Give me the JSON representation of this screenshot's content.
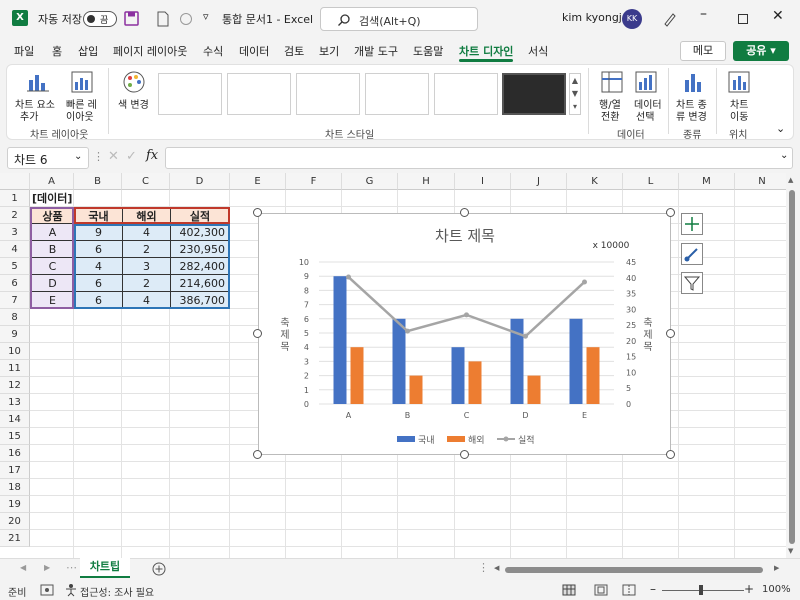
{
  "titlebar": {
    "autosave_label": "자동 저장",
    "toggle_state": "끔",
    "doc_title": "통합 문서1  -  Excel",
    "search_placeholder": "검색(Alt+Q)",
    "user_name": "kim kyongja",
    "user_initials": "KK",
    "brand_color": "#107c41"
  },
  "tabs": [
    "파일",
    "홈",
    "삽입",
    "페이지 레이아웃",
    "수식",
    "데이터",
    "검토",
    "보기",
    "개발 도구",
    "도움말",
    "차트 디자인",
    "서식"
  ],
  "active_tab": "차트 디자인",
  "ribbon": {
    "add_element_l1": "차트 요소",
    "add_element_l2": "추가",
    "quick_layout_l1": "빠른 레",
    "quick_layout_l2": "이아웃",
    "change_color": "색 변경",
    "switch_l1": "행/열",
    "switch_l2": "전환",
    "select_data_l1": "데이터",
    "select_data_l2": "선택",
    "change_type_l1": "차트 종",
    "change_type_l2": "류 변경",
    "move_chart_l1": "차트",
    "move_chart_l2": "이동",
    "group_layouts": "차트 레이아웃",
    "group_styles": "차트 스타일",
    "group_data": "데이터",
    "group_type": "종류",
    "group_location": "위치",
    "memo": "메모",
    "share": "공유"
  },
  "formula_bar": {
    "name_box": "차트 6",
    "fx": "fx"
  },
  "columns": [
    "A",
    "B",
    "C",
    "D",
    "E",
    "F",
    "G",
    "H",
    "I",
    "J",
    "K",
    "L",
    "M",
    "N"
  ],
  "rows": [
    "1",
    "2",
    "3",
    "4",
    "5",
    "6",
    "7",
    "8",
    "9",
    "10",
    "11",
    "12",
    "13",
    "14",
    "15",
    "16",
    "17",
    "18",
    "19",
    "20",
    "21"
  ],
  "sheet": {
    "a1": "[데이터]",
    "headers": [
      "상품",
      "국내",
      "해외",
      "실적"
    ],
    "data": [
      [
        "A",
        "9",
        "4",
        "402,300"
      ],
      [
        "B",
        "6",
        "2",
        "230,950"
      ],
      [
        "C",
        "4",
        "3",
        "282,400"
      ],
      [
        "D",
        "6",
        "2",
        "214,600"
      ],
      [
        "E",
        "6",
        "4",
        "386,700"
      ]
    ]
  },
  "chart_data": {
    "type": "bar",
    "title": "차트 제목",
    "secondary_unit": "x 10000",
    "ylabel": "축 제목",
    "y2label": "축 제목",
    "categories": [
      "A",
      "B",
      "C",
      "D",
      "E"
    ],
    "ylim": [
      0,
      10
    ],
    "y_ticks": [
      "0",
      "1",
      "2",
      "3",
      "4",
      "5",
      "6",
      "7",
      "8",
      "9",
      "10"
    ],
    "y2lim": [
      0,
      45
    ],
    "y2_ticks": [
      "0",
      "5",
      "10",
      "15",
      "20",
      "25",
      "30",
      "35",
      "40",
      "45"
    ],
    "series": [
      {
        "name": "국내",
        "kind": "bar",
        "axis": "primary",
        "color": "#4472c4",
        "values": [
          9,
          6,
          4,
          6,
          6
        ]
      },
      {
        "name": "해외",
        "kind": "bar",
        "axis": "primary",
        "color": "#ed7d31",
        "values": [
          4,
          2,
          3,
          2,
          4
        ]
      },
      {
        "name": "실적",
        "kind": "line",
        "axis": "secondary",
        "color": "#a5a5a5",
        "values": [
          40.23,
          23.095,
          28.24,
          21.46,
          38.67
        ]
      }
    ],
    "legend": "bottom",
    "grid": true
  },
  "sheet_tab": "차트팁",
  "status": {
    "ready": "준비",
    "accessibility": "접근성: 조사 필요",
    "zoom": "100%"
  }
}
